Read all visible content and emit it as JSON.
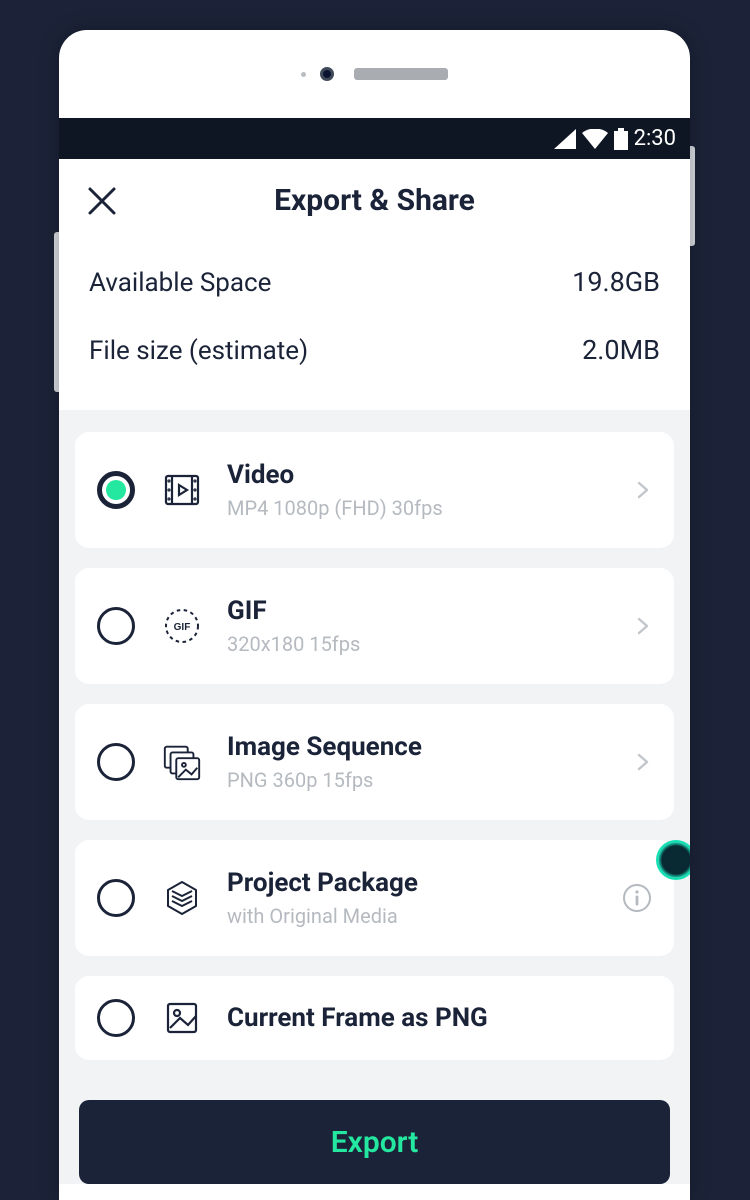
{
  "statusbar": {
    "time": "2:30"
  },
  "header": {
    "title": "Export & Share"
  },
  "info": {
    "available_label": "Available Space",
    "available_value": "19.8GB",
    "filesize_label": "File size (estimate)",
    "filesize_value": "2.0MB"
  },
  "options": [
    {
      "title": "Video",
      "subtitle": "MP4 1080p (FHD) 30fps",
      "selected": true,
      "has_chevron": true,
      "trailing": "chevron"
    },
    {
      "title": "GIF",
      "subtitle": "320x180 15fps",
      "selected": false,
      "has_chevron": true,
      "trailing": "chevron"
    },
    {
      "title": "Image Sequence",
      "subtitle": "PNG 360p 15fps",
      "selected": false,
      "has_chevron": true,
      "trailing": "chevron"
    },
    {
      "title": "Project Package",
      "subtitle": "with Original Media",
      "selected": false,
      "has_chevron": false,
      "trailing": "info"
    },
    {
      "title": "Current Frame as PNG",
      "subtitle": "",
      "selected": false,
      "has_chevron": false,
      "trailing": "none"
    }
  ],
  "gif_badge_text": "GIF",
  "export_button": "Export",
  "colors": {
    "accent": "#24e8a0",
    "dark": "#1b2338"
  }
}
